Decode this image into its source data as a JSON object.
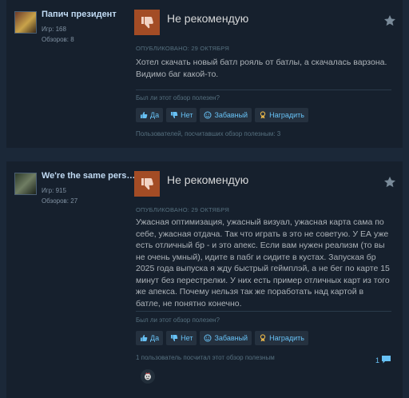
{
  "reviews": [
    {
      "author_name": "Папич президент",
      "games": "Игр: 168",
      "reviews_count": "Обзоров: 8",
      "rating": "Не рекомендую",
      "posted": "ОПУБЛИКОВАНО: 29 ОКТЯБРЯ",
      "text": "Хотел скачать новый батл рояль от батлы, а скачалась варзона. Видимо баг какой-то.",
      "helpful_question": "Был ли этот обзор полезен?",
      "btn_yes": "Да",
      "btn_no": "Нет",
      "btn_funny": "Забавный",
      "btn_award": "Наградить",
      "helpful_count": "Пользователей, посчитавших обзор полезным: 3"
    },
    {
      "author_name": "We're the same pers…",
      "games": "Игр: 915",
      "reviews_count": "Обзоров: 27",
      "rating": "Не рекомендую",
      "posted": "ОПУБЛИКОВАНО: 29 ОКТЯБРЯ",
      "text": "Ужасная оптимизация, ужасный визуал, ужасная карта сама по себе, ужасная отдача. Так что играть в это не советую. У ЕА уже есть отличный бр - и это апекс. Если вам нужен реализм (то вы не очень умный), идите в пабг и сидите в кустах. Запуская бр 2025 года выпуска я жду быстрый геймплэй, а не бег по карте 15 минут без перестрелки. У них есть пример отличных карт из того же апекса. Почему нельзя так же поработать над картой в батле, не понятно конечно.",
      "helpful_question": "Был ли этот обзор полезен?",
      "btn_yes": "Да",
      "btn_no": "Нет",
      "btn_funny": "Забавный",
      "btn_award": "Наградить",
      "helpful_count": "1 пользователь посчитал этот обзор полезным",
      "comment_count": "1"
    }
  ],
  "colors": {
    "page_bg": "#1b2838",
    "card_bg": "#16202d",
    "not_recommended": "#a34c25",
    "link_blue": "#67c1f5",
    "award_gold": "#e8b64a"
  },
  "icons": [
    "thumbs-down-icon",
    "star-icon",
    "thumbs-up-icon",
    "smiley-icon",
    "award-ribbon-icon",
    "comment-bubble-icon",
    "award-badge-icon"
  ]
}
